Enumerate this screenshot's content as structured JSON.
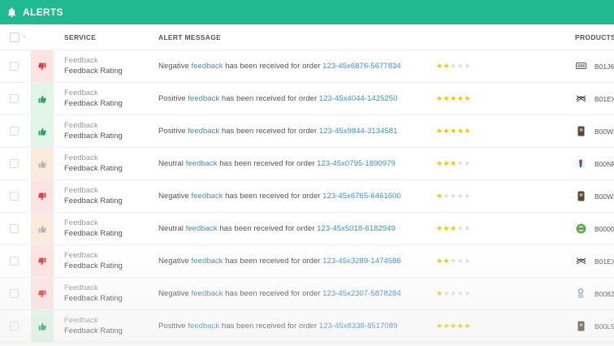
{
  "header": {
    "title": "ALERTS",
    "icon": "bell-icon",
    "color": "#21b990"
  },
  "columns": {
    "service": "SERVICE",
    "alert_message": "ALERT MESSAGE",
    "products": "PRODUCTS"
  },
  "rows": [
    {
      "status": "negative",
      "service": "Feedback",
      "service_sub": "Feedback Rating",
      "sentiment": "Negative",
      "link_word": "feedback",
      "middle": "has been received for order",
      "order": "123-45x6876-5677834",
      "rating": 2,
      "product_icon": "keyboard-icon",
      "product_code": "B01J6"
    },
    {
      "status": "positive",
      "service": "Feedback",
      "service_sub": "Feedback Rating",
      "sentiment": "Positive",
      "link_word": "feedback",
      "middle": "has been received for order",
      "order": "123-45x4044-1425250",
      "rating": 5,
      "product_icon": "headphones-icon",
      "product_code": "B01EX"
    },
    {
      "status": "positive",
      "service": "Feedback",
      "service_sub": "Feedback Rating",
      "sentiment": "Positive",
      "link_word": "feedback",
      "middle": "has been received for order",
      "order": "123-45x9844-3134581",
      "rating": 5,
      "product_icon": "phone-case-icon",
      "product_code": "B00WX"
    },
    {
      "status": "neutral",
      "service": "Feedback",
      "service_sub": "Feedback Rating",
      "sentiment": "Neutral",
      "link_word": "feedback",
      "middle": "has been received for order",
      "order": "123-45x0795-1890979",
      "rating": 3,
      "product_icon": "figurine-icon",
      "product_code": "B00NF"
    },
    {
      "status": "negative",
      "service": "Feedback",
      "service_sub": "Feedback Rating",
      "sentiment": "Negative",
      "link_word": "feedback",
      "middle": "has been received for order",
      "order": "123-45x6765-6461600",
      "rating": 1,
      "product_icon": "phone-case-icon",
      "product_code": "B00WX"
    },
    {
      "status": "neutral",
      "service": "Feedback",
      "service_sub": "Feedback Rating",
      "sentiment": "Neutral",
      "link_word": "feedback",
      "middle": "has been received for order",
      "order": "123-45x5018-6182949",
      "rating": 3,
      "product_icon": "badge-icon",
      "product_code": "B0000"
    },
    {
      "status": "negative",
      "service": "Feedback",
      "service_sub": "Feedback Rating",
      "sentiment": "Negative",
      "link_word": "feedback",
      "middle": "has been received for order",
      "order": "123-45x3289-1474586",
      "rating": 2,
      "product_icon": "headphones-icon",
      "product_code": "B01EX"
    },
    {
      "status": "negative",
      "service": "Feedback",
      "service_sub": "Feedback Rating",
      "sentiment": "Negative",
      "link_word": "feedback",
      "middle": "has been received for order",
      "order": "123-45x2307-5878284",
      "rating": 1,
      "product_icon": "earbuds-icon",
      "product_code": "B0082"
    },
    {
      "status": "positive",
      "service": "Feedback",
      "service_sub": "Feedback Rating",
      "sentiment": "Positive",
      "link_word": "feedback",
      "middle": "has been received for order",
      "order": "123-45x8338-8517089",
      "rating": 5,
      "product_icon": "phone-case-icon",
      "product_code": "B00L5"
    }
  ],
  "colors": {
    "negative": "#d64545",
    "positive": "#2fa35f",
    "neutral": "#b8b8b8",
    "link": "#3d8fd8",
    "star_on": "#f0c40f",
    "star_off": "#dedede"
  }
}
